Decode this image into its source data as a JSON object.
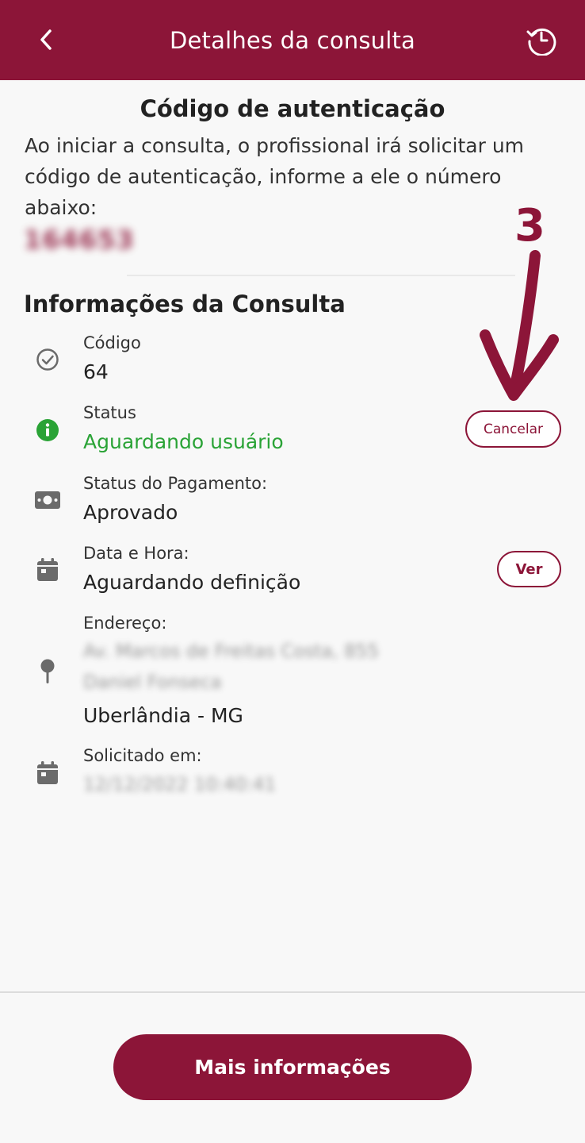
{
  "header": {
    "title": "Detalhes da consulta",
    "back_icon": "chevron-left-icon",
    "history_icon": "history-clock-icon"
  },
  "auth": {
    "title": "Código de autenticação",
    "description": "Ao iniciar a consulta, o profissional irá solicitar um código de autenticação, informe a ele o número abaixo:",
    "code": "164653"
  },
  "annotation": {
    "number": "3"
  },
  "info": {
    "section_title": "Informações da Consulta",
    "codigo": {
      "label": "Código",
      "value": "64",
      "icon": "check-circle-icon"
    },
    "status": {
      "label": "Status",
      "value": "Aguardando usuário",
      "icon": "info-icon",
      "color": "#2aa336"
    },
    "cancel_button": "Cancelar",
    "payment": {
      "label": "Status do Pagamento:",
      "value": "Aprovado",
      "icon": "money-icon"
    },
    "datetime": {
      "label": "Data e Hora:",
      "value": "Aguardando definição",
      "icon": "calendar-icon"
    },
    "ver_button": "Ver",
    "address": {
      "label": "Endereço:",
      "line1": "Av. Marcos de Freitas Costa, 855",
      "line2": "Daniel Fonseca",
      "city": "Uberlândia - MG",
      "icon": "map-pin-icon"
    },
    "requested": {
      "label": "Solicitado em:",
      "value": "12/12/2022 10:40:41",
      "icon": "calendar-icon"
    }
  },
  "footer": {
    "button": "Mais informações"
  },
  "colors": {
    "brand": "#8c1538",
    "status_green": "#2aa336"
  }
}
